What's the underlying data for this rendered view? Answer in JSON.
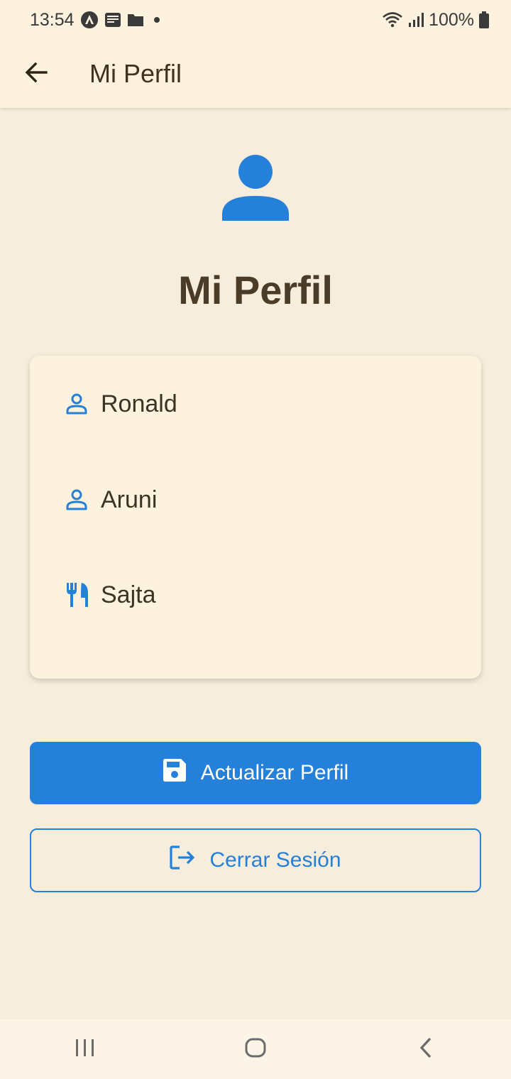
{
  "status_bar": {
    "time": "13:54",
    "battery": "100%",
    "icons": [
      "android-auto-icon",
      "news-app-icon",
      "folder-icon",
      "dot-icon",
      "wifi-icon",
      "signal-icon",
      "battery-icon"
    ]
  },
  "app_bar": {
    "title": "Mi Perfil",
    "back_icon": "arrow-back-icon"
  },
  "profile": {
    "avatar_icon": "person-icon",
    "heading": "Mi Perfil",
    "fields": [
      {
        "icon": "person-outline-icon",
        "value": "Ronald"
      },
      {
        "icon": "person-outline-icon",
        "value": "Aruni"
      },
      {
        "icon": "restaurant-icon",
        "value": "Sajta"
      }
    ]
  },
  "actions": {
    "update_label": "Actualizar Perfil",
    "update_icon": "save-icon",
    "logout_label": "Cerrar Sesión",
    "logout_icon": "logout-icon"
  },
  "nav_bar": {
    "buttons": [
      "recents-icon",
      "home-icon",
      "back-icon"
    ]
  },
  "colors": {
    "accent": "#2580d9",
    "background": "#f7eddc",
    "surface": "#fdf2de",
    "text": "#4a3c26"
  }
}
